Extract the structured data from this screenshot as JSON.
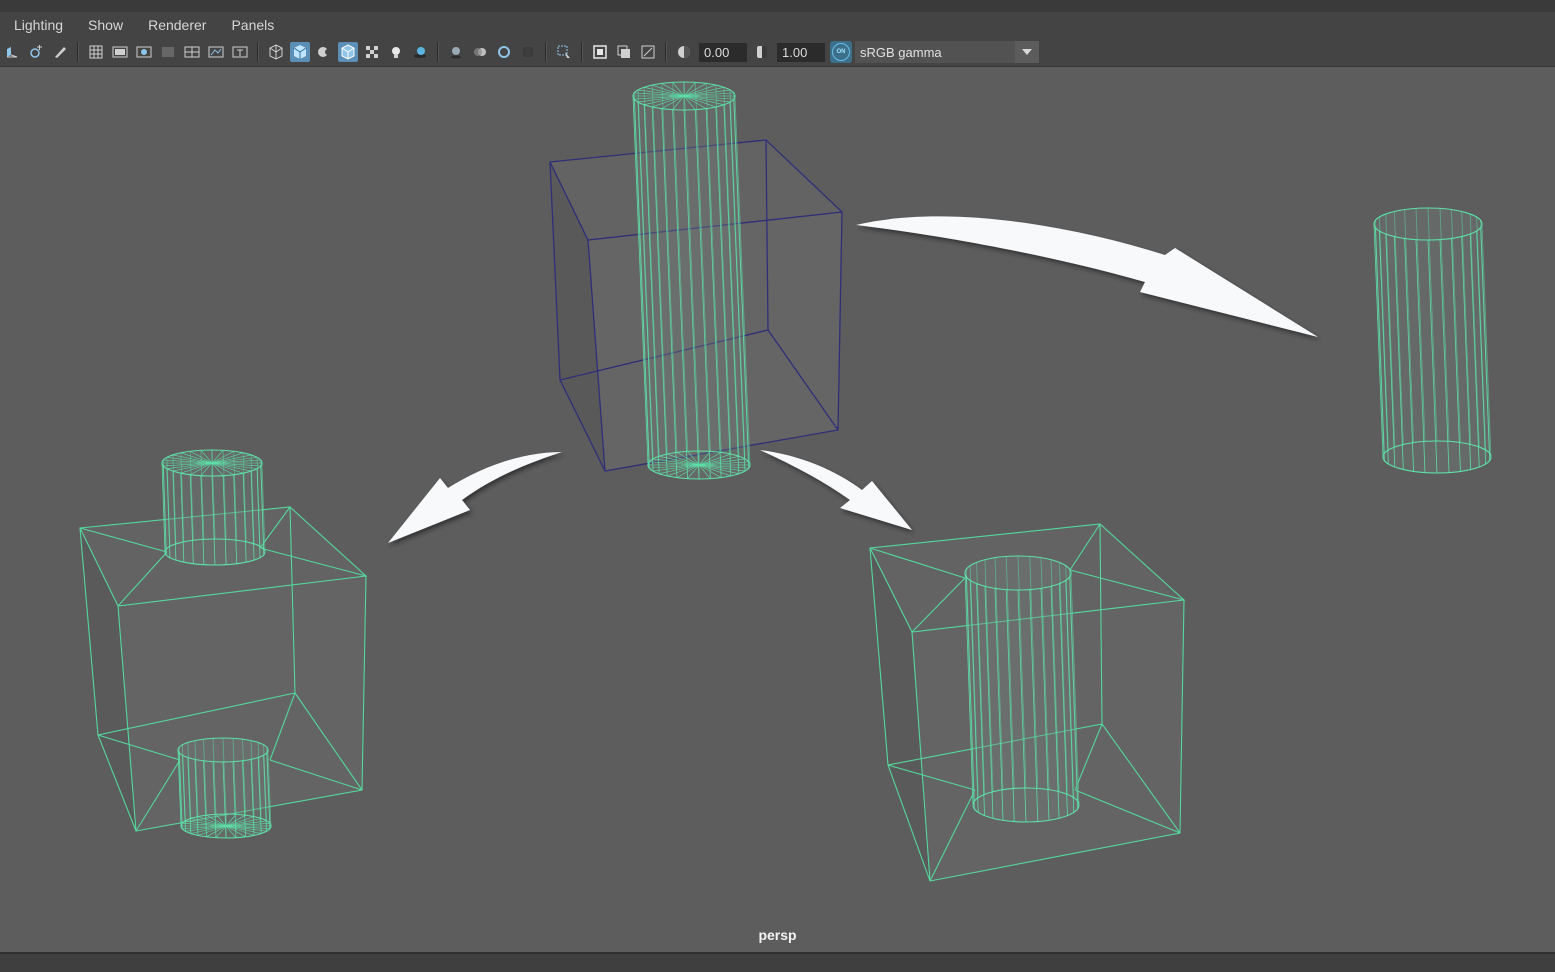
{
  "menubar": {
    "items": [
      "Lighting",
      "Show",
      "Renderer",
      "Panels"
    ]
  },
  "toolbar": {
    "exposure_value": "0.00",
    "gamma_value": "1.00",
    "color_mgmt_badge": "ON",
    "color_space": "sRGB gamma",
    "icons": [
      "camera-attributes-icon",
      "bookmark-icon",
      "image-plane-icon",
      "grid-icon",
      "film-gate-icon",
      "resolution-gate-icon",
      "gate-mask-icon",
      "field-chart-icon",
      "safe-action-icon",
      "safe-title-icon",
      "wireframe-icon",
      "smooth-shade-icon",
      "default-material-icon",
      "wireframe-on-shaded-icon",
      "textured-icon",
      "use-all-lights-icon",
      "shadows-icon",
      "screen-space-ao-icon",
      "motion-blur-icon",
      "multisample-aa-icon",
      "depth-of-field-icon",
      "isolate-select-icon",
      "xray-icon",
      "xray-active-components-icon",
      "xray-joints-icon",
      "exposure-icon",
      "gamma-icon"
    ]
  },
  "viewport": {
    "camera_label": "persp",
    "background": "#5d5d5d",
    "wire_color": "#5ee0a8",
    "cube_wire_color": "#2f2f78"
  }
}
